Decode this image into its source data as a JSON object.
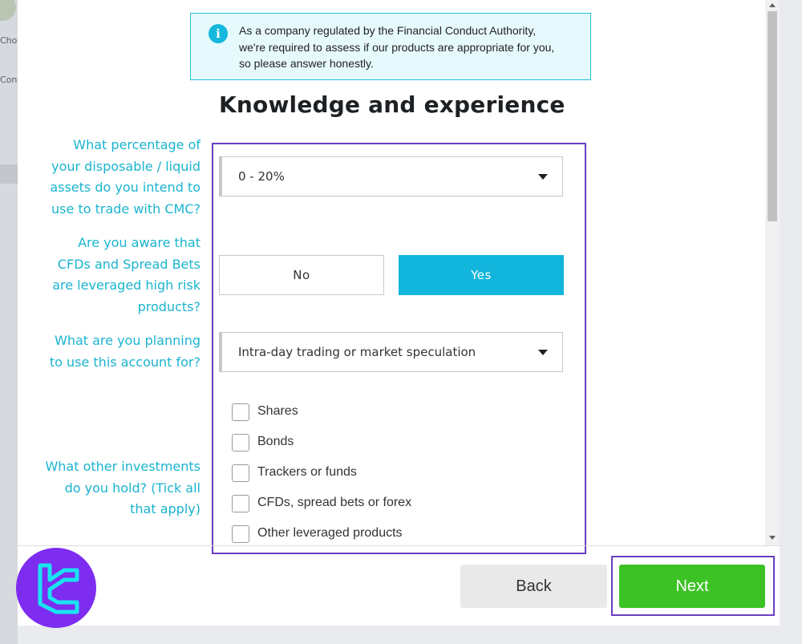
{
  "background": {
    "partial_labels": [
      "Choo",
      "Conf"
    ]
  },
  "info": {
    "icon": "info-icon",
    "lines": [
      "As a company regulated by the Financial Conduct Authority,",
      "we're required to assess if our products are appropriate for you,",
      "so please answer honestly."
    ]
  },
  "page_title": "Knowledge and experience",
  "questions": {
    "disposable_assets": {
      "label_lines": [
        "What percentage of",
        "your disposable / liquid",
        "assets do you intend to",
        "use to trade with CMC?"
      ],
      "selected": "0 - 20%"
    },
    "leverage_awareness": {
      "label_lines": [
        "Are you aware that",
        "CFDs and Spread Bets",
        "are leveraged high risk",
        "products?"
      ],
      "options": [
        "No",
        "Yes"
      ],
      "selected": "Yes"
    },
    "account_purpose": {
      "label_lines": [
        "What are you planning",
        "to use this account for?"
      ],
      "selected": "Intra-day trading or market speculation"
    },
    "other_investments": {
      "label_lines": [
        "What other investments",
        "do you hold? (Tick all",
        "that apply)"
      ],
      "options": [
        "Shares",
        "Bonds",
        "Trackers or funds",
        "CFDs, spread bets or forex",
        "Other leveraged products"
      ]
    }
  },
  "buttons": {
    "back": "Back",
    "next": "Next"
  },
  "colors": {
    "accent": "#12b5dc",
    "label": "#1ab4cf",
    "next": "#3dc226",
    "highlight": "#6a3fc2",
    "logo": "#7d2cf0"
  }
}
